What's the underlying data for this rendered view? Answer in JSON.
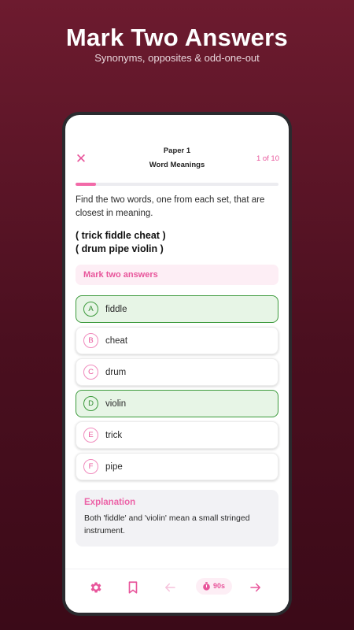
{
  "hero": {
    "title": "Mark Two Answers",
    "subtitle": "Synonyms, opposites & odd-one-out"
  },
  "header": {
    "paper": "Paper 1",
    "topic": "Word Meanings",
    "progress_text": "1 of 10",
    "progress_fraction": 0.1
  },
  "question": {
    "prompt": "Find the two words, one from each set, that are closest in meaning.",
    "set1": "( trick fiddle cheat )",
    "set2": "( drum pipe violin )"
  },
  "instruction": "Mark two answers",
  "options": [
    {
      "letter": "A",
      "text": "fiddle",
      "selected": true
    },
    {
      "letter": "B",
      "text": "cheat",
      "selected": false
    },
    {
      "letter": "C",
      "text": "drum",
      "selected": false
    },
    {
      "letter": "D",
      "text": "violin",
      "selected": true
    },
    {
      "letter": "E",
      "text": "trick",
      "selected": false
    },
    {
      "letter": "F",
      "text": "pipe",
      "selected": false
    }
  ],
  "explanation": {
    "title": "Explanation",
    "body": "Both 'fiddle' and 'violin' mean a small stringed instrument."
  },
  "bottom_bar": {
    "timer": "90s",
    "icons": [
      "gear-icon",
      "bookmark-icon",
      "arrow-left-icon",
      "stopwatch-icon",
      "arrow-right-icon"
    ]
  },
  "colors": {
    "accent": "#e8559b",
    "selected_border": "#3c9a3c",
    "selected_bg": "#e7f5e6",
    "background": "#5a1427"
  }
}
